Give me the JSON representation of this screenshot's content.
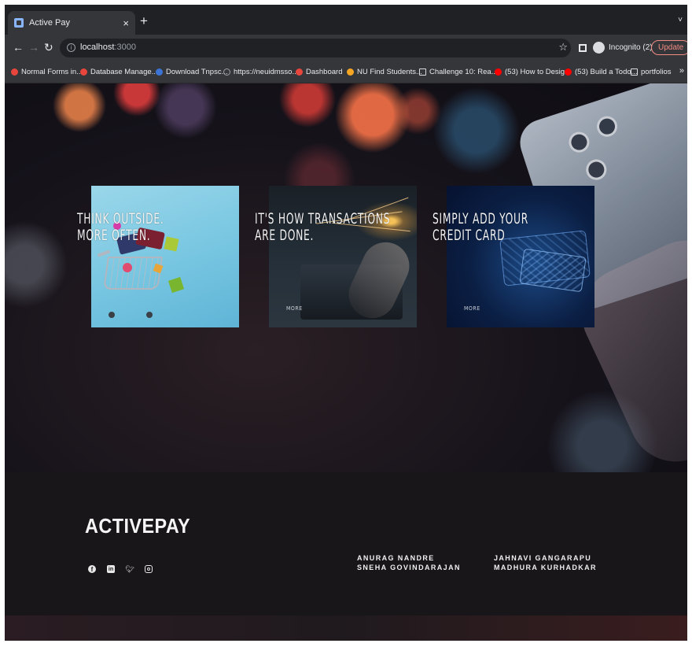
{
  "browser": {
    "tab_title": "Active Pay",
    "tab_close": "×",
    "new_tab": "+",
    "tab_list": "˅",
    "url_host": "localhost",
    "url_port": ":3000",
    "incognito_label": "Incognito (2)",
    "update_label": "Update",
    "more_bookmarks": "»"
  },
  "bookmarks": [
    {
      "label": "Normal Forms in...",
      "color": "#e8453c"
    },
    {
      "label": "Database Manage...",
      "color": "#e8453c"
    },
    {
      "label": "Download Tnpsc...",
      "color": "#3c74d6"
    },
    {
      "label": "https://neuidmsso...",
      "color": "#9aa0a6"
    },
    {
      "label": "Dashboard",
      "color": "#e8453c"
    },
    {
      "label": "NU Find Students...",
      "color": "#f6a623"
    },
    {
      "label": "Challenge 10: Rea...",
      "color": "#dadce0"
    },
    {
      "label": "(53) How to Desig...",
      "color": "#ff0000"
    },
    {
      "label": "(53) Build a Todo...",
      "color": "#ff0000"
    },
    {
      "label": "portfolios",
      "color": "#dadce0"
    }
  ],
  "cards": [
    {
      "line1": "THINK OUTSIDE.",
      "line2": "MORE OFTEN."
    },
    {
      "line1": "IT'S HOW TRANSACTIONS",
      "line2": "ARE DONE.",
      "more": "MORE"
    },
    {
      "line1": "SIMPLY ADD YOUR",
      "line2": "CREDIT CARD",
      "more": "MORE"
    }
  ],
  "footer": {
    "brand": "ACTIVEPAY",
    "names_col1": [
      "ANURAG NANDRE",
      "SNEHA GOVINDARAJAN"
    ],
    "names_col2": [
      "JAHNAVI GANGARAPU",
      "MADHURA KURHADKAR"
    ],
    "social_icons": [
      "facebook-icon",
      "linkedin-icon",
      "twitter-icon",
      "instagram-icon"
    ]
  }
}
